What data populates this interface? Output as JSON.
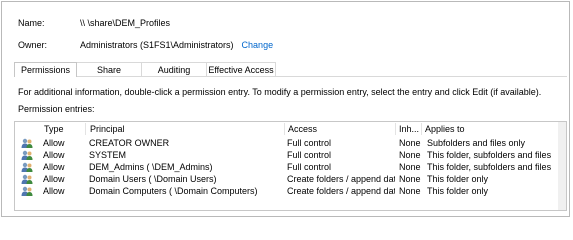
{
  "header": {
    "name_label": "Name:",
    "name_value": "\\\\                       \\share\\DEM_Profiles",
    "owner_label": "Owner:",
    "owner_value": "Administrators (S1FS1\\Administrators)",
    "change_label": "Change"
  },
  "tabs": [
    {
      "label": "Permissions",
      "active": true
    },
    {
      "label": "Share",
      "active": false
    },
    {
      "label": "Auditing",
      "active": false
    },
    {
      "label": "Effective Access",
      "active": false
    }
  ],
  "info_text": "For additional information, double-click a permission entry. To modify a permission entry, select the entry and click Edit (if available).",
  "entries_label": "Permission entries:",
  "table": {
    "columns": [
      "Type",
      "Principal",
      "Access",
      "Inh...",
      "Applies to"
    ],
    "rows": [
      {
        "icon": "users-icon",
        "type": "Allow",
        "principal": "CREATOR OWNER",
        "access": "Full control",
        "inherited": "None",
        "applies": "Subfolders and files only"
      },
      {
        "icon": "users-icon",
        "type": "Allow",
        "principal": "SYSTEM",
        "access": "Full control",
        "inherited": "None",
        "applies": "This folder, subfolders and files"
      },
      {
        "icon": "users-icon",
        "type": "Allow",
        "principal": "DEM_Admins (                  \\DEM_Admins)",
        "access": "Full control",
        "inherited": "None",
        "applies": "This folder, subfolders and files"
      },
      {
        "icon": "users-icon",
        "type": "Allow",
        "principal": "Domain Users (            \\Domain Users)",
        "access": "Create folders / append data",
        "inherited": "None",
        "applies": "This folder only"
      },
      {
        "icon": "users-icon",
        "type": "Allow",
        "principal": "Domain Computers (              \\Domain Computers)",
        "access": "Create folders / append data",
        "inherited": "None",
        "applies": "This folder only"
      }
    ]
  },
  "colors": {
    "link": "#0066cc",
    "border": "#c7c7c7"
  }
}
